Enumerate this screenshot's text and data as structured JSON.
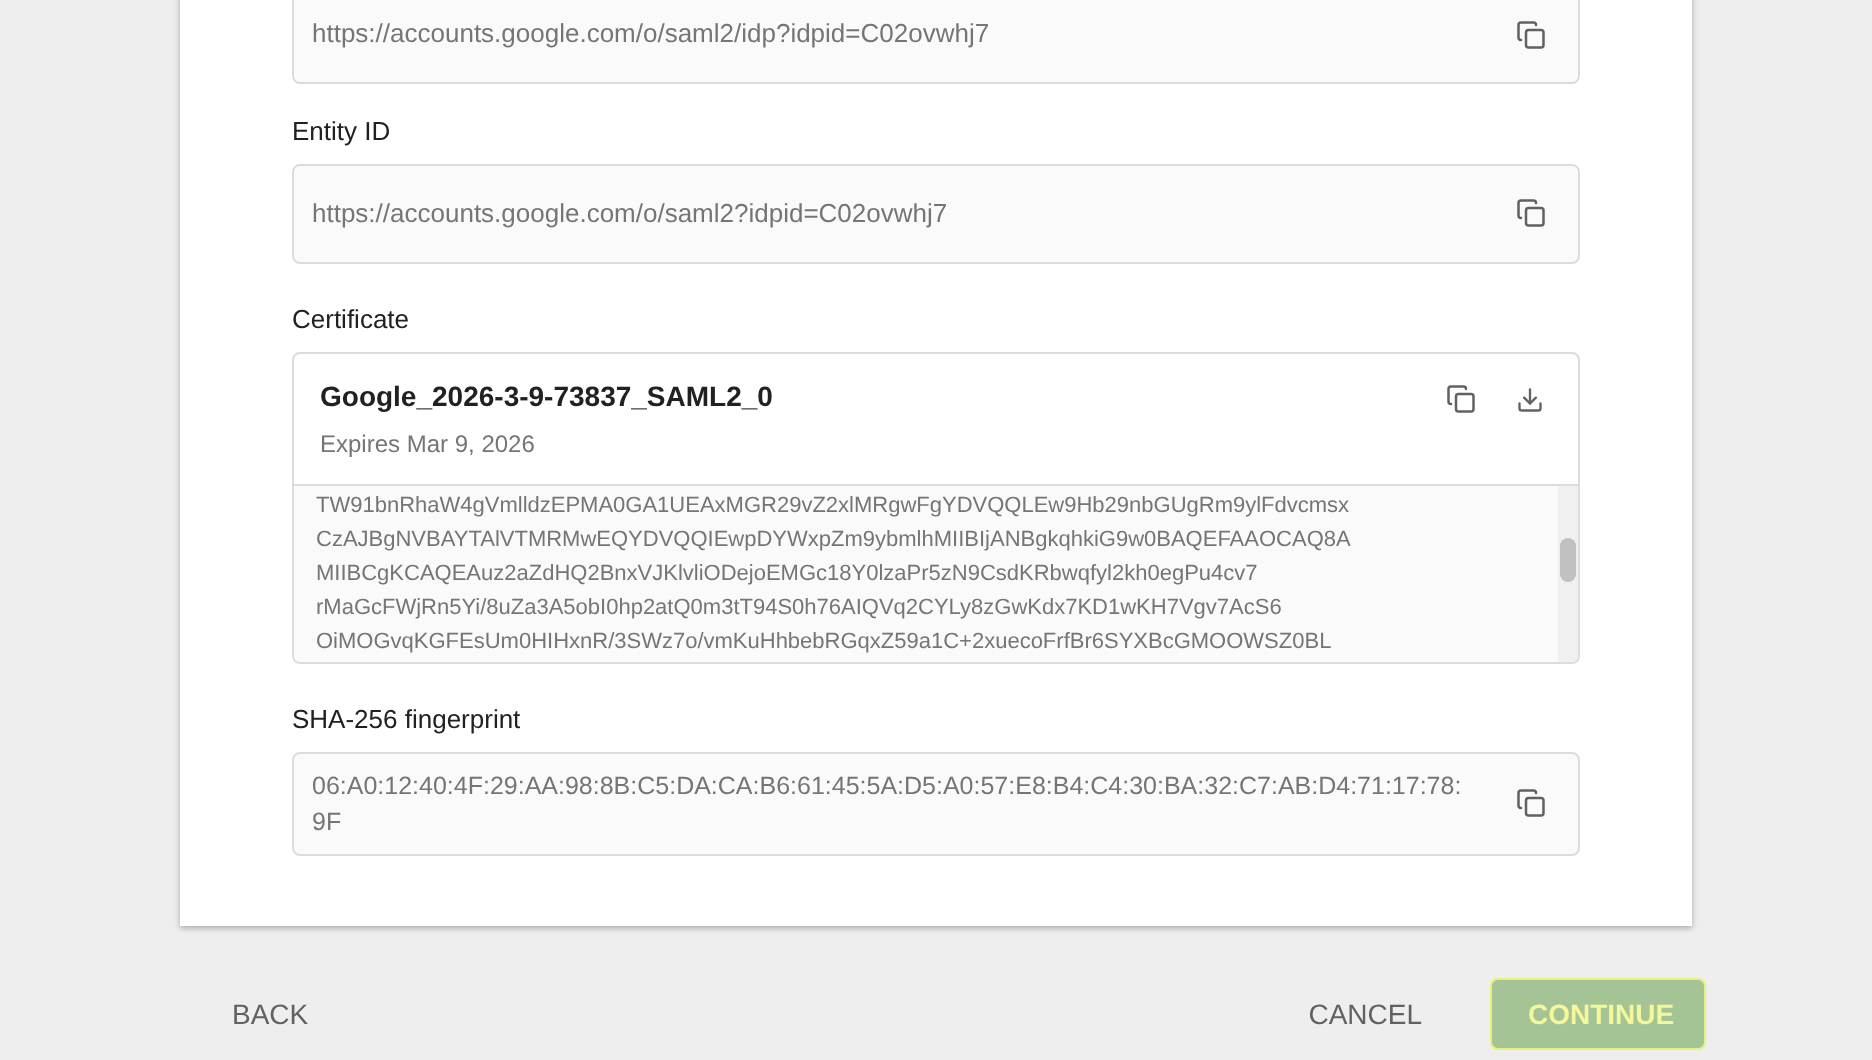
{
  "fields": [
    {
      "kind": "text",
      "value": "https://accounts.google.com/o/saml2/idp?idpid=C02ovwhj7"
    },
    {
      "kind": "text",
      "label": "Entity ID",
      "value": "https://accounts.google.com/o/saml2?idpid=C02ovwhj7"
    }
  ],
  "certificate": {
    "label": "Certificate",
    "name": "Google_2026-3-9-73837_SAML2_0",
    "expiry": "Expires Mar 9, 2026",
    "lines": [
      "TW91bnRhaW4gVmlldzEPMA0GA1UEAxMGR29vZ2xlMRgwFgYDVQQLEw9Hb29nbGUgRm9ylFdvcmsx",
      "CzAJBgNVBAYTAlVTMRMwEQYDVQQIEwpDYWxpZm9ybmlhMIIBIjANBgkqhkiG9w0BAQEFAAOCAQ8A",
      "MIIBCgKCAQEAuz2aZdHQ2BnxVJKlvliODejoEMGc18Y0lzaPr5zN9CsdKRbwqfyl2kh0egPu4cv7",
      "rMaGcFWjRn5Yi/8uZa3A5obI0hp2atQ0m3tT94S0h76AIQVq2CYLy8zGwKdx7KD1wKH7Vgv7AcS6",
      "OiMOGvqKGFEsUm0HIHxnR/3SWz7o/vmKuHhbebRGqxZ59a1C+2xuecoFrfBr6SYXBcGMOOWSZ0BL"
    ]
  },
  "fingerprint": {
    "label": "SHA-256 fingerprint",
    "value": "06:A0:12:40:4F:29:AA:98:8B:C5:DA:CA:B6:61:45:5A:D5:A0:57:E8:B4:C4:30:BA:32:C7:AB:D4:71:17:78:9F"
  },
  "footer": {
    "back": "BACK",
    "cancel": "CANCEL",
    "continue": {
      "label": "CONTINUE",
      "disabled": true
    }
  }
}
